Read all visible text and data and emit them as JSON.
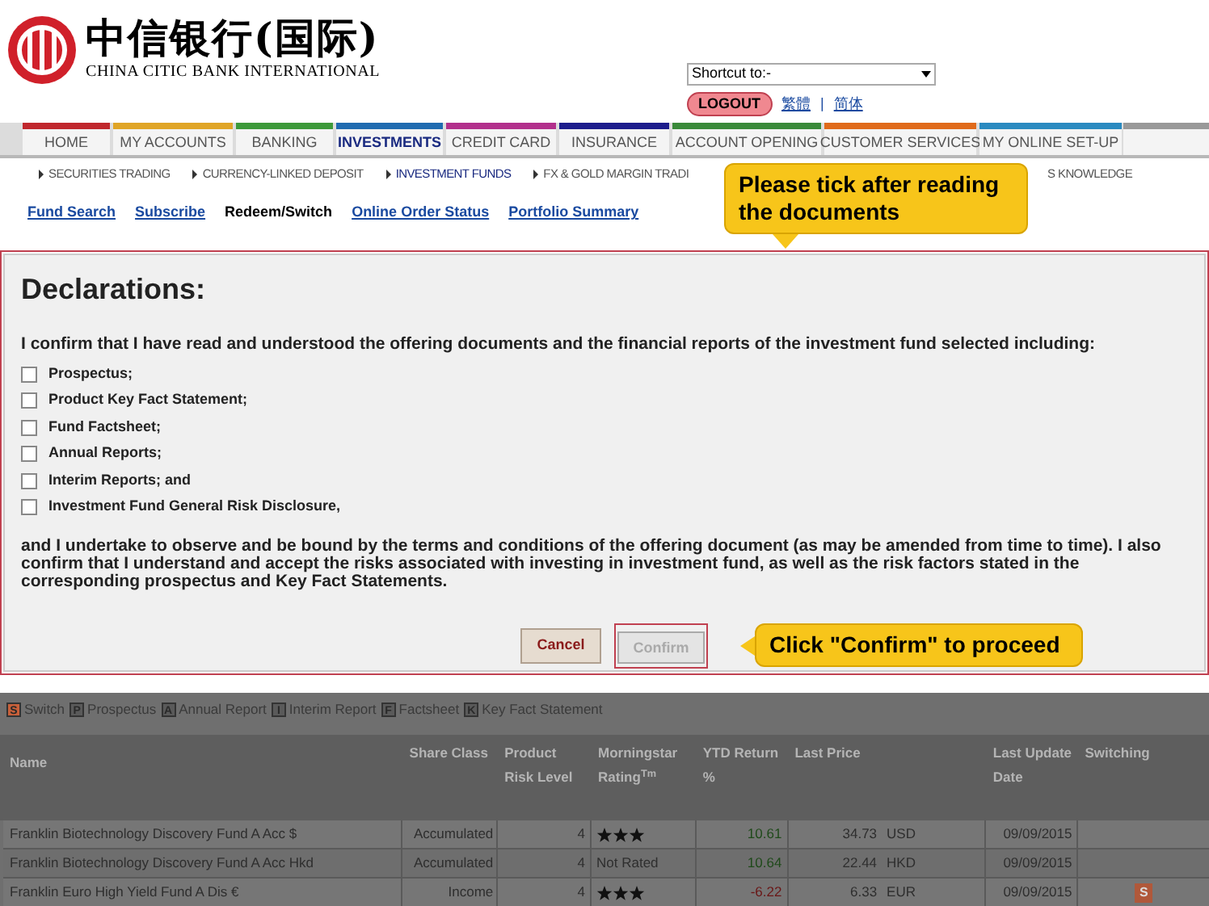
{
  "header": {
    "logo_cn": "中信银行(国际)",
    "logo_en": "CHINA CITIC BANK INTERNATIONAL",
    "shortcut": {
      "value": "Shortcut to:-"
    },
    "logout": "LOGOUT",
    "languages": [
      "繁體",
      "简体"
    ],
    "separator": "|"
  },
  "nav": [
    {
      "label": "HOME",
      "color": "#c0272d",
      "selected": false
    },
    {
      "label": "MY ACCOUNTS",
      "color": "#e0a526",
      "selected": false
    },
    {
      "label": "BANKING",
      "color": "#3d9a3a",
      "selected": false
    },
    {
      "label": "INVESTMENTS",
      "color": "#1f6bb0",
      "selected": true
    },
    {
      "label": "CREDIT CARD",
      "color": "#b2308c",
      "selected": false
    },
    {
      "label": "INSURANCE",
      "color": "#1c1c8c",
      "selected": false
    },
    {
      "label": "ACCOUNT OPENING",
      "color": "#3a8a3a",
      "selected": false
    },
    {
      "label": "CUSTOMER SERVICES",
      "color": "#e06a1a",
      "selected": false
    },
    {
      "label": "MY ONLINE SET-UP",
      "color": "#2a8ac0",
      "selected": false
    }
  ],
  "subnav": [
    {
      "label": "SECURITIES TRADING",
      "selected": false
    },
    {
      "label": "CURRENCY-LINKED DEPOSIT",
      "selected": false
    },
    {
      "label": "INVESTMENT FUNDS",
      "selected": true
    },
    {
      "label": "FX & GOLD MARGIN TRADI",
      "selected": false
    },
    {
      "label": "S KNOWLEDGE",
      "selected": false
    }
  ],
  "links": [
    {
      "label": "Fund Search",
      "selected": false
    },
    {
      "label": "Subscribe",
      "selected": false
    },
    {
      "label": "Redeem/Switch",
      "selected": true
    },
    {
      "label": "Online Order Status",
      "selected": false
    },
    {
      "label": "Portfolio Summary",
      "selected": false
    }
  ],
  "tips": [
    "Please tick after reading the documents",
    "Click \"Confirm\" to proceed"
  ],
  "dialog": {
    "title": "Declarations:",
    "intro": "I confirm that I have read and understood the offering documents and the financial reports of the investment fund selected including:",
    "items": [
      {
        "label": "Prospectus;",
        "checked": false
      },
      {
        "label": "Product Key Fact Statement;",
        "checked": false
      },
      {
        "label": "Fund Factsheet;",
        "checked": false
      },
      {
        "label": "Annual Reports;",
        "checked": false
      },
      {
        "label": "Interim Reports; and",
        "checked": false
      },
      {
        "label": "Investment Fund General Risk Disclosure,",
        "checked": false
      }
    ],
    "paragraph": "and I undertake to observe and be bound by the terms and conditions of the offering document (as may be amended from time to time). I also confirm that I understand and accept the risks associated with investing in investment fund, as well as the risk factors stated in the corresponding prospectus and Key Fact Statements.",
    "cancel": "Cancel",
    "confirm": {
      "label": "Confirm",
      "disabled": true
    }
  },
  "legend": [
    {
      "key": "S",
      "label": "Switch",
      "color": "#c8603a"
    },
    {
      "key": "P",
      "label": "Prospectus",
      "color": "#5a5a5a"
    },
    {
      "key": "A",
      "label": "Annual Report",
      "color": "#5a5a5a"
    },
    {
      "key": "I",
      "label": "Interim Report",
      "color": "#5a5a5a"
    },
    {
      "key": "F",
      "label": "Factsheet",
      "color": "#5a5a5a"
    },
    {
      "key": "K",
      "label": "Key Fact Statement",
      "color": "#5a5a5a"
    }
  ],
  "table": {
    "columns": [
      "Name",
      "Share Class",
      "Product Risk Level",
      "Morningstar Rating$^{Tm}$",
      "YTD Return %",
      "Last Price",
      "",
      "Last Update Date",
      "Switching"
    ],
    "rows": [
      {
        "name": "Franklin Biotechnology Discovery Fund A Acc $",
        "share_class": "Accumulated",
        "risk": "4",
        "rating": {
          "kind": "stars",
          "stars": 3
        },
        "ytd": {
          "text": "10.61",
          "color": "#1f4a1a"
        },
        "price": "34.73",
        "currency": "USD",
        "date": "09/09/2015"
      },
      {
        "name": "Franklin Biotechnology Discovery Fund A Acc Hkd",
        "share_class": "Accumulated",
        "risk": "4",
        "rating": {
          "kind": "text",
          "text": "Not Rated"
        },
        "ytd": {
          "text": "10.64",
          "color": "#1f4a1a"
        },
        "price": "22.44",
        "currency": "HKD",
        "date": "09/09/2015"
      },
      {
        "name": "Franklin Euro High Yield Fund A Dis €",
        "share_class": "Income",
        "risk": "4",
        "rating": {
          "kind": "stars",
          "stars": 3
        },
        "ytd": {
          "text": "-6.22",
          "color": "#6a1515"
        },
        "price": "6.33",
        "currency": "EUR",
        "date": "09/09/2015",
        "switching": "S"
      }
    ]
  }
}
